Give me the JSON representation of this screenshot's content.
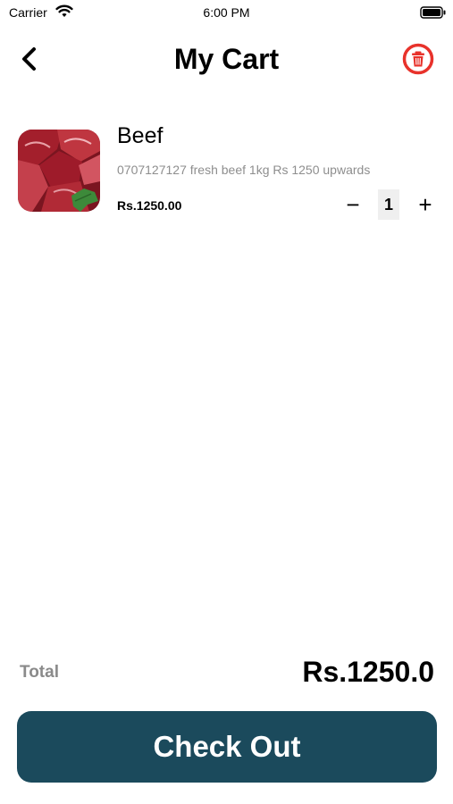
{
  "status_bar": {
    "carrier": "Carrier",
    "time": "6:00 PM"
  },
  "header": {
    "title": "My Cart"
  },
  "cart": {
    "items": [
      {
        "name": "Beef",
        "description": "0707127127 fresh beef 1kg Rs 1250 upwards",
        "price": "Rs.1250.00",
        "quantity": "1",
        "minus_symbol": "−",
        "plus_symbol": "+"
      }
    ]
  },
  "summary": {
    "total_label": "Total",
    "total_value": "Rs.1250.0"
  },
  "checkout": {
    "label": "Check Out"
  },
  "colors": {
    "checkout_bg": "#1b4a5c",
    "trash_accent": "#e8322b",
    "muted_text": "#8e8e8e"
  },
  "icons": [
    "wifi-icon",
    "battery-icon",
    "back-chevron-icon",
    "trash-icon",
    "beef-image"
  ]
}
